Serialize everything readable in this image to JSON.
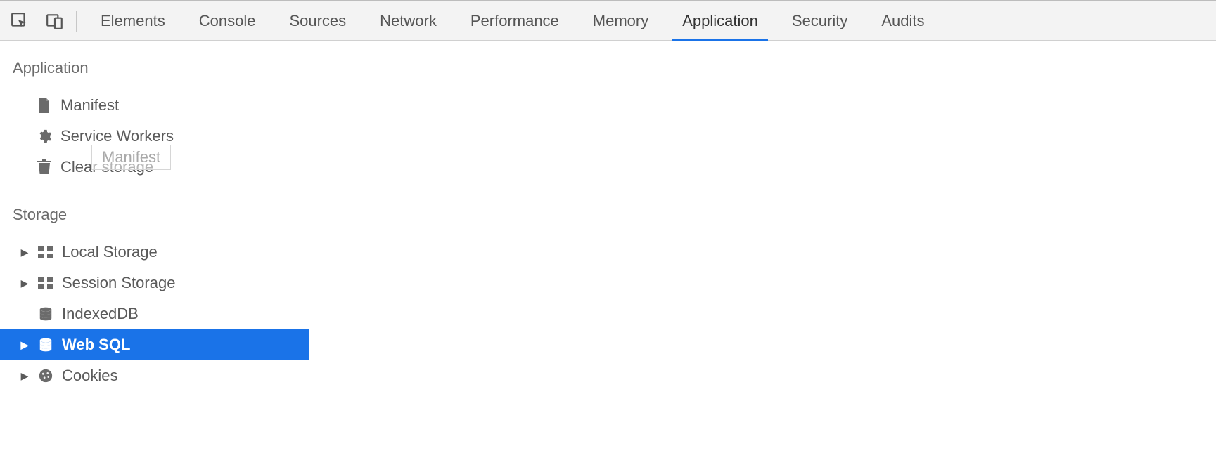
{
  "tabs": {
    "items": [
      {
        "label": "Elements",
        "active": false
      },
      {
        "label": "Console",
        "active": false
      },
      {
        "label": "Sources",
        "active": false
      },
      {
        "label": "Network",
        "active": false
      },
      {
        "label": "Performance",
        "active": false
      },
      {
        "label": "Memory",
        "active": false
      },
      {
        "label": "Application",
        "active": true
      },
      {
        "label": "Security",
        "active": false
      },
      {
        "label": "Audits",
        "active": false
      }
    ]
  },
  "sidebar": {
    "tooltip_text": "Manifest",
    "sections": [
      {
        "title": "Application",
        "items": [
          {
            "label": "Manifest",
            "icon": "file-icon",
            "expandable": false,
            "selected": false
          },
          {
            "label": "Service Workers",
            "icon": "gear-icon",
            "expandable": false,
            "selected": false
          },
          {
            "label": "Clear storage",
            "icon": "trash-icon",
            "expandable": false,
            "selected": false
          }
        ]
      },
      {
        "title": "Storage",
        "items": [
          {
            "label": "Local Storage",
            "icon": "grid-icon",
            "expandable": true,
            "selected": false
          },
          {
            "label": "Session Storage",
            "icon": "grid-icon",
            "expandable": true,
            "selected": false
          },
          {
            "label": "IndexedDB",
            "icon": "database-icon",
            "expandable": false,
            "selected": false
          },
          {
            "label": "Web SQL",
            "icon": "database-icon",
            "expandable": true,
            "selected": true
          },
          {
            "label": "Cookies",
            "icon": "cookie-icon",
            "expandable": true,
            "selected": false
          }
        ]
      }
    ]
  }
}
